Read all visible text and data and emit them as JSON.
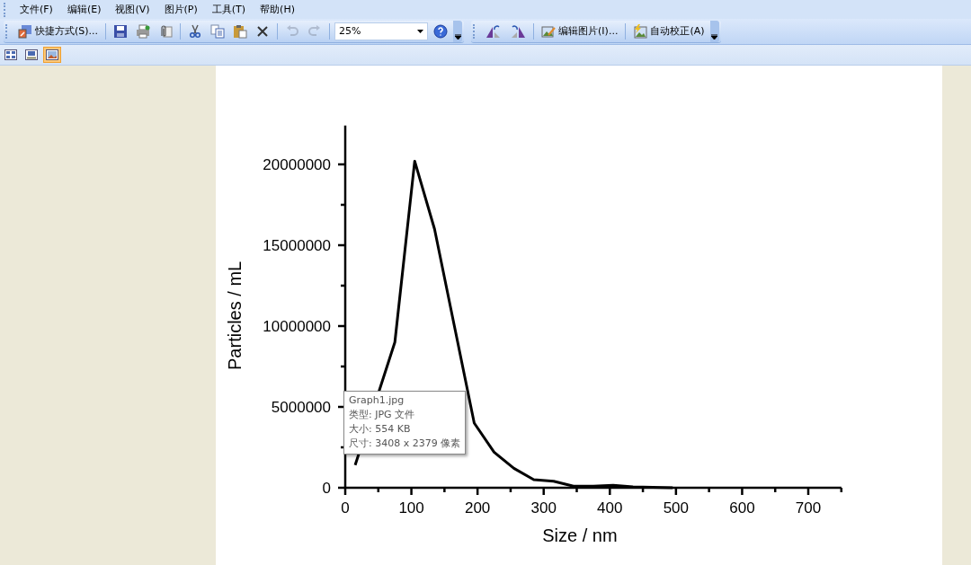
{
  "menu": [
    "文件(F)",
    "编辑(E)",
    "视图(V)",
    "图片(P)",
    "工具(T)",
    "帮助(H)"
  ],
  "toolbar": {
    "shortcut": "快捷方式(S)...",
    "tools": [
      {
        "kind": "save",
        "disabled": false
      },
      {
        "kind": "print",
        "disabled": false
      },
      {
        "kind": "attach",
        "disabled": false
      },
      {
        "kind": "cut",
        "disabled": false
      },
      {
        "kind": "copy",
        "disabled": false
      },
      {
        "kind": "paste",
        "disabled": false
      },
      {
        "kind": "delete",
        "disabled": false
      },
      {
        "kind": "undo",
        "disabled": true
      },
      {
        "kind": "redo",
        "disabled": true
      }
    ],
    "zoom": "25%",
    "edit_picture": "编辑图片(I)...",
    "auto_correct": "自动校正(A)"
  },
  "view_modes": [
    {
      "selected": false
    },
    {
      "selected": false
    },
    {
      "selected": true
    }
  ],
  "chart_data": {
    "type": "line",
    "xlabel": "Size / nm",
    "ylabel": "Particles / mL",
    "x": [
      15,
      75,
      105,
      135,
      165,
      195,
      225,
      255,
      285,
      315,
      345,
      375,
      405,
      435,
      465,
      495
    ],
    "series": [
      {
        "color": "#000000",
        "values": [
          1400000,
          9000000,
          20200000,
          16000000,
          10000000,
          4000000,
          2200000,
          1200000,
          500000,
          400000,
          100000,
          100000,
          150000,
          50000,
          30000,
          0
        ]
      }
    ],
    "xlim": [
      0,
      750
    ],
    "ylim": [
      0,
      22400000
    ],
    "xticks": [
      0,
      100,
      200,
      300,
      400,
      500,
      600,
      700
    ],
    "yticks": [
      0,
      5000000,
      10000000,
      15000000,
      20000000
    ]
  },
  "tooltip": {
    "lines": [
      "Graph1.jpg",
      "类型: JPG 文件",
      "大小: 554 KB",
      "尺寸: 3408 x 2379 像素"
    ]
  }
}
